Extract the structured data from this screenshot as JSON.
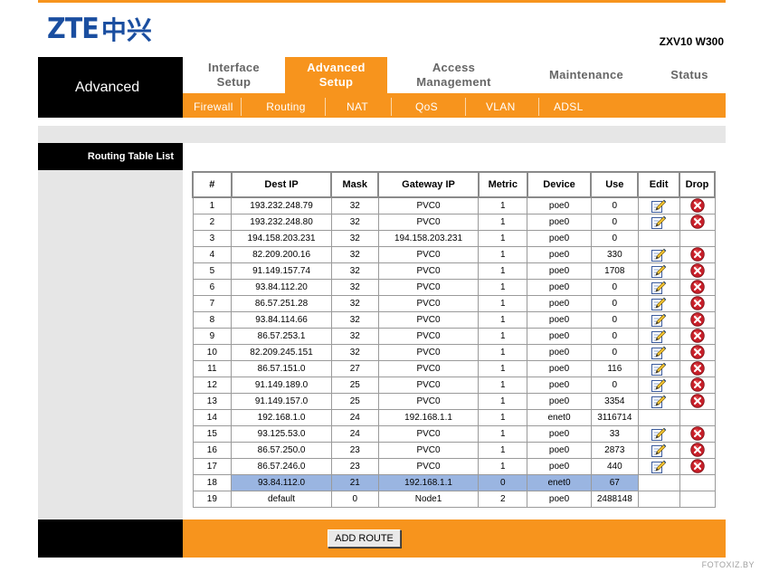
{
  "brand": {
    "logo_latin": "ZTE",
    "logo_chinese": "中兴",
    "model": "ZXV10 W300"
  },
  "section_title": "Advanced",
  "main_nav": [
    {
      "line1": "Interface",
      "line2": "Setup",
      "active": false
    },
    {
      "line1": "Advanced",
      "line2": "Setup",
      "active": true
    },
    {
      "line1": "Access",
      "line2": "Management",
      "active": false
    },
    {
      "line1": "Maintenance",
      "line2": "",
      "active": false
    },
    {
      "line1": "Status",
      "line2": "",
      "active": false
    }
  ],
  "sub_nav": [
    {
      "label": "Firewall",
      "active": false
    },
    {
      "label": "Routing",
      "active": true
    },
    {
      "label": "NAT",
      "active": false
    },
    {
      "label": "QoS",
      "active": false
    },
    {
      "label": "VLAN",
      "active": false
    },
    {
      "label": "ADSL",
      "active": false
    }
  ],
  "left_panel_title": "Routing Table List",
  "table": {
    "headers": [
      "#",
      "Dest IP",
      "Mask",
      "Gateway IP",
      "Metric",
      "Device",
      "Use",
      "Edit",
      "Drop"
    ],
    "rows": [
      {
        "n": "1",
        "dest": "193.232.248.79",
        "mask": "32",
        "gw": "PVC0",
        "metric": "1",
        "dev": "poe0",
        "use": "0",
        "editable": true,
        "droppable": true
      },
      {
        "n": "2",
        "dest": "193.232.248.80",
        "mask": "32",
        "gw": "PVC0",
        "metric": "1",
        "dev": "poe0",
        "use": "0",
        "editable": true,
        "droppable": true
      },
      {
        "n": "3",
        "dest": "194.158.203.231",
        "mask": "32",
        "gw": "194.158.203.231",
        "metric": "1",
        "dev": "poe0",
        "use": "0",
        "editable": false,
        "droppable": false
      },
      {
        "n": "4",
        "dest": "82.209.200.16",
        "mask": "32",
        "gw": "PVC0",
        "metric": "1",
        "dev": "poe0",
        "use": "330",
        "editable": true,
        "droppable": true
      },
      {
        "n": "5",
        "dest": "91.149.157.74",
        "mask": "32",
        "gw": "PVC0",
        "metric": "1",
        "dev": "poe0",
        "use": "1708",
        "editable": true,
        "droppable": true
      },
      {
        "n": "6",
        "dest": "93.84.112.20",
        "mask": "32",
        "gw": "PVC0",
        "metric": "1",
        "dev": "poe0",
        "use": "0",
        "editable": true,
        "droppable": true
      },
      {
        "n": "7",
        "dest": "86.57.251.28",
        "mask": "32",
        "gw": "PVC0",
        "metric": "1",
        "dev": "poe0",
        "use": "0",
        "editable": true,
        "droppable": true
      },
      {
        "n": "8",
        "dest": "93.84.114.66",
        "mask": "32",
        "gw": "PVC0",
        "metric": "1",
        "dev": "poe0",
        "use": "0",
        "editable": true,
        "droppable": true
      },
      {
        "n": "9",
        "dest": "86.57.253.1",
        "mask": "32",
        "gw": "PVC0",
        "metric": "1",
        "dev": "poe0",
        "use": "0",
        "editable": true,
        "droppable": true
      },
      {
        "n": "10",
        "dest": "82.209.245.151",
        "mask": "32",
        "gw": "PVC0",
        "metric": "1",
        "dev": "poe0",
        "use": "0",
        "editable": true,
        "droppable": true
      },
      {
        "n": "11",
        "dest": "86.57.151.0",
        "mask": "27",
        "gw": "PVC0",
        "metric": "1",
        "dev": "poe0",
        "use": "116",
        "editable": true,
        "droppable": true
      },
      {
        "n": "12",
        "dest": "91.149.189.0",
        "mask": "25",
        "gw": "PVC0",
        "metric": "1",
        "dev": "poe0",
        "use": "0",
        "editable": true,
        "droppable": true
      },
      {
        "n": "13",
        "dest": "91.149.157.0",
        "mask": "25",
        "gw": "PVC0",
        "metric": "1",
        "dev": "poe0",
        "use": "3354",
        "editable": true,
        "droppable": true
      },
      {
        "n": "14",
        "dest": "192.168.1.0",
        "mask": "24",
        "gw": "192.168.1.1",
        "metric": "1",
        "dev": "enet0",
        "use": "3116714",
        "editable": false,
        "droppable": false
      },
      {
        "n": "15",
        "dest": "93.125.53.0",
        "mask": "24",
        "gw": "PVC0",
        "metric": "1",
        "dev": "poe0",
        "use": "33",
        "editable": true,
        "droppable": true
      },
      {
        "n": "16",
        "dest": "86.57.250.0",
        "mask": "23",
        "gw": "PVC0",
        "metric": "1",
        "dev": "poe0",
        "use": "2873",
        "editable": true,
        "droppable": true
      },
      {
        "n": "17",
        "dest": "86.57.246.0",
        "mask": "23",
        "gw": "PVC0",
        "metric": "1",
        "dev": "poe0",
        "use": "440",
        "editable": true,
        "droppable": true
      },
      {
        "n": "18",
        "dest": "93.84.112.0",
        "mask": "21",
        "gw": "192.168.1.1",
        "metric": "0",
        "dev": "enet0",
        "use": "67",
        "editable": false,
        "droppable": false,
        "highlighted": true
      },
      {
        "n": "19",
        "dest": "default",
        "mask": "0",
        "gw": "Node1",
        "metric": "2",
        "dev": "poe0",
        "use": "2488148",
        "editable": false,
        "droppable": false
      }
    ]
  },
  "add_route_label": "ADD ROUTE",
  "watermark": "FOTOXIZ.BY",
  "icons": {
    "edit": "edit-pencil-icon",
    "drop": "delete-x-icon"
  },
  "colors": {
    "accent": "#f7941d",
    "brand": "#1a4ea0",
    "highlight": "#9ab5e1",
    "drop": "#c8202a"
  }
}
